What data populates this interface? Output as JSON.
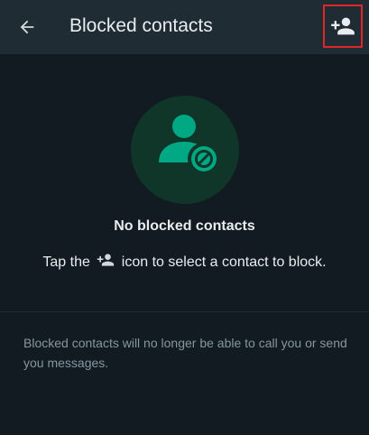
{
  "header": {
    "title": "Blocked contacts",
    "back_icon": "arrow-left-icon",
    "add_icon": "add-person-icon"
  },
  "empty_state": {
    "illustration_icon": "blocked-person-icon",
    "title": "No blocked contacts",
    "hint_before": "Tap the",
    "hint_icon": "add-person-icon",
    "hint_after": "icon to select a contact to block."
  },
  "footnote": "Blocked contacts will no longer be able to call you or send you messages.",
  "colors": {
    "background": "#111b21",
    "app_bar": "#1f2c34",
    "accent": "#00a884",
    "illustration_bg": "#103529",
    "text_primary": "#e9edef",
    "text_secondary": "#8696a0",
    "highlight_box": "#e0262a"
  }
}
